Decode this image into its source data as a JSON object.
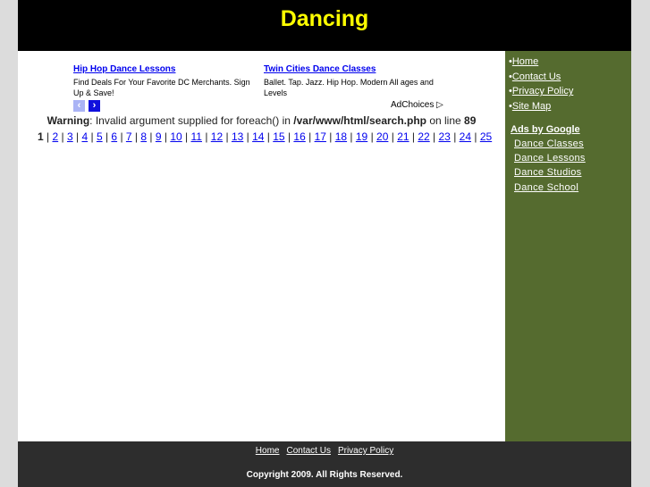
{
  "header": {
    "title": "Dancing"
  },
  "ads": [
    {
      "title": "Hip Hop Dance Lessons",
      "text": "Find Deals For Your Favorite DC Merchants. Sign Up & Save!"
    },
    {
      "title": "Twin Cities Dance Classes",
      "text": "Ballet. Tap. Jazz. Hip Hop. Modern All ages and Levels"
    }
  ],
  "adchoices": "AdChoices",
  "warning": {
    "label": "Warning",
    "text1": ": Invalid argument supplied for foreach() in ",
    "path": "/var/www/html/search.php",
    "text2": " on line ",
    "line": "89"
  },
  "pagination": {
    "current": "1",
    "pages": [
      "2",
      "3",
      "4",
      "5",
      "6",
      "7",
      "8",
      "9",
      "10",
      "11",
      "12",
      "13",
      "14",
      "15",
      "16",
      "17",
      "18",
      "19",
      "20",
      "21",
      "22",
      "23",
      "24",
      "25"
    ]
  },
  "sidebar": {
    "links": [
      "Home",
      "Contact Us",
      "Privacy Policy",
      "Site Map"
    ],
    "ads_title": "Ads by Google",
    "ad_links": [
      "Dance Classes",
      "Dance Lessons",
      "Dance Studios",
      "Dance School"
    ]
  },
  "footer": {
    "links": [
      "Home",
      "Contact Us",
      "Privacy Policy"
    ],
    "copyright": "Copyright 2009. All Rights Reserved."
  },
  "colors": {
    "title": "#ffff00",
    "sidebar": "#556b2f",
    "footer": "#2d2d2d",
    "link": "#0000ee"
  }
}
